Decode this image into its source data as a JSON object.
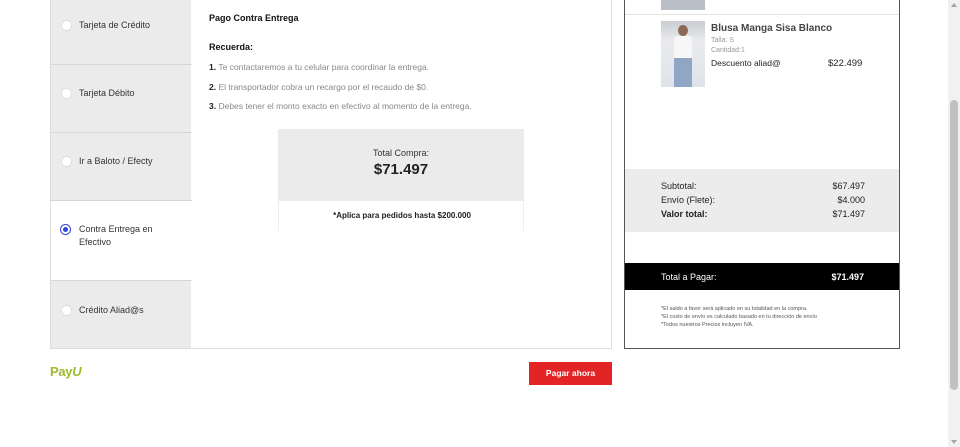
{
  "payment_methods": [
    {
      "label": "Tarjeta de Crédito",
      "selected": false
    },
    {
      "label": "Tarjeta Débito",
      "selected": false
    },
    {
      "label": "Ir a Baloto / Efecty",
      "selected": false
    },
    {
      "label": "Contra Entrega en Efectivo",
      "selected": true
    },
    {
      "label": "Crédito Aliad@s",
      "selected": false
    }
  ],
  "content": {
    "title": "Pago Contra Entrega",
    "remember_title": "Recuerda:",
    "steps": [
      {
        "num": "1.",
        "text": "Te contactaremos a tu celular para coordinar la entrega."
      },
      {
        "num": "2.",
        "text": "El transportador cobra un recargo por el recaudo de $0."
      },
      {
        "num": "3.",
        "text": "Debes tener el monto exacto en efectivo al momento de la entrega."
      }
    ],
    "total_label": "Total Compra:",
    "total_value": "$71.497",
    "note": "*Aplica para pedidos hasta $200.000"
  },
  "summary": {
    "product": {
      "name": "Blusa Manga Sisa Blanco",
      "size": "Talla: S",
      "quantity": "Cantidad:1",
      "discount_label": "Descuento aliad@",
      "price": "$22.499"
    },
    "subtotal_label": "Subtotal:",
    "subtotal_value": "$67.497",
    "shipping_label": "Envío (Flete):",
    "shipping_value": "$4.000",
    "total_label": "Valor total:",
    "total_value": "$71.497",
    "pay_label": "Total a Pagar:",
    "pay_value": "$71.497",
    "fine_print": [
      "*El saldo a favor será aplicado en su totalidad en la compra.",
      "*El costo de envío es calculado basado en tu dirección de envío",
      "*Todos nuestros Precios incluyen IVA."
    ]
  },
  "footer": {
    "brand_pay": "Pay",
    "brand_u": "U",
    "pay_button": "Pagar ahora"
  },
  "colors": {
    "accent": "#e22424",
    "radio_selected": "#3344dd",
    "brand": "#9fbb2c"
  }
}
